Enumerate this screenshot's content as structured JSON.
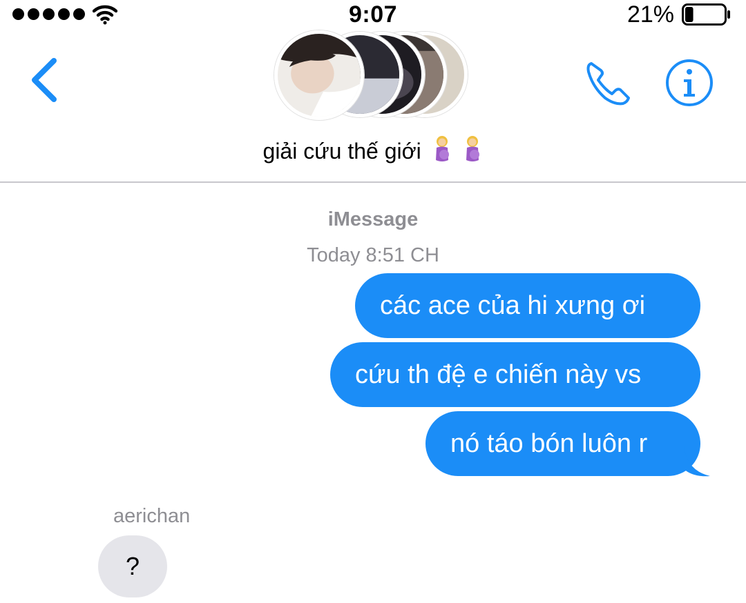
{
  "status_bar": {
    "time": "9:07",
    "battery_percent_label": "21%",
    "battery_level": 0.21,
    "signal_bars": 5
  },
  "header": {
    "group_name": "giải cứu thế giới",
    "emoji_icons": [
      "pregnant-woman-emoji",
      "pregnant-woman-emoji"
    ]
  },
  "conversation": {
    "service": "iMessage",
    "timestamp": "Today 8:51 CH",
    "outgoing_messages": [
      "các ace của hi xưng ơi",
      "cứu th đệ e chiến này vs",
      "nó táo bón luôn r"
    ],
    "incoming": {
      "sender": "aerichan",
      "message": "?"
    }
  },
  "colors": {
    "accent": "#1b8df7",
    "incoming_bubble": "#e5e5ea",
    "secondary_text": "#8e8e93",
    "divider": "#c8c7cc"
  }
}
